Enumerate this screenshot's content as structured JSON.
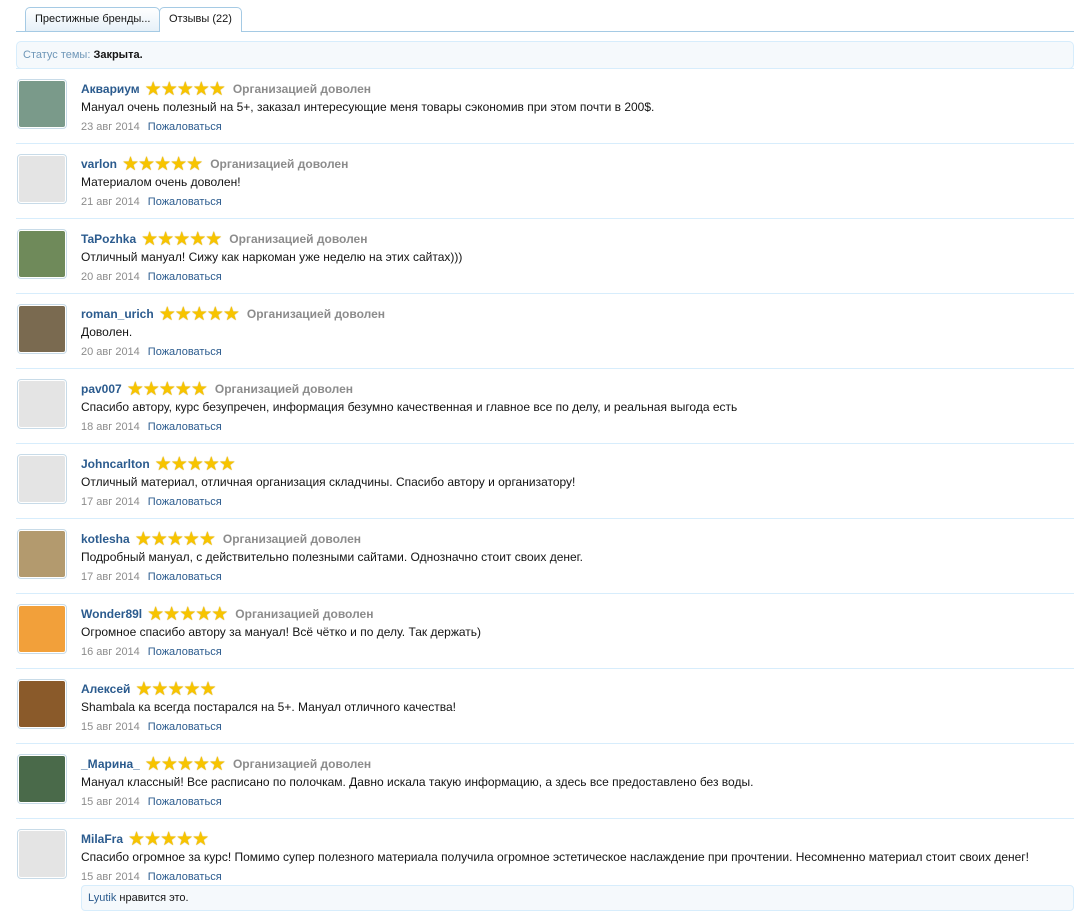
{
  "tabs": [
    {
      "label": "Престижные бренды..."
    },
    {
      "label": "Отзывы (22)"
    }
  ],
  "status": {
    "label": "Статус темы:",
    "value": "Закрыта."
  },
  "report_label": "Пожаловаться",
  "stars": "★★★★★",
  "rating_max": 5,
  "reviews": [
    {
      "name": "Аквариум",
      "rating": 5,
      "rating_text": "Организацией доволен",
      "message": "Мануал очень полезный на 5+, заказал интересующие меня товары сэкономив при этом почти в 200$.",
      "date": "23 авг 2014",
      "avatar_color": "#7a9a8a"
    },
    {
      "name": "varlon",
      "rating": 5,
      "rating_text": "Организацией доволен",
      "message": "Материалом очень доволен!",
      "date": "21 авг 2014",
      "avatar_color": "#e4e4e4"
    },
    {
      "name": "TaPozhka",
      "rating": 5,
      "rating_text": "Организацией доволен",
      "message": "Отличный мануал! Сижу как наркоман уже неделю на этих сайтах)))",
      "date": "20 авг 2014",
      "avatar_color": "#6f8a5a"
    },
    {
      "name": "roman_urich",
      "rating": 5,
      "rating_text": "Организацией доволен",
      "message": "Доволен.",
      "date": "20 авг 2014",
      "avatar_color": "#7a6a50"
    },
    {
      "name": "pav007",
      "rating": 5,
      "rating_text": "Организацией доволен",
      "message": "Спасибо автору, курс безупречен, информация безумно качественная и главное все по делу, и реальная выгода есть",
      "date": "18 авг 2014",
      "avatar_color": "#e4e4e4"
    },
    {
      "name": "Johncarlton",
      "rating": 5,
      "rating_text": "",
      "message": "Отличный материал, отличная организация складчины. Спасибо автору и организатору!",
      "date": "17 авг 2014",
      "avatar_color": "#e4e4e4"
    },
    {
      "name": "kotlesha",
      "rating": 5,
      "rating_text": "Организацией доволен",
      "message": "Подробный мануал, с действительно полезными сайтами. Однозначно стоит своих денег.",
      "date": "17 авг 2014",
      "avatar_color": "#b39a6e"
    },
    {
      "name": "Wonder89l",
      "rating": 5,
      "rating_text": "Организацией доволен",
      "message": "Огромное спасибо автору за мануал! Всё чётко и по делу. Так держать)",
      "date": "16 авг 2014",
      "avatar_color": "#f2a03a"
    },
    {
      "name": "Алексей",
      "rating": 5,
      "rating_text": "",
      "message": "Shambala ка всегда постарался на 5+. Мануал отличного качества!",
      "date": "15 авг 2014",
      "avatar_color": "#8a5a2a"
    },
    {
      "name": "_Марина_",
      "rating": 5,
      "rating_text": "Организацией доволен",
      "message": "Мануал классный! Все расписано по полочкам. Давно искала такую информацию, а здесь все предоставлено без воды.",
      "date": "15 авг 2014",
      "avatar_color": "#4a6a4a"
    },
    {
      "name": "MilaFra",
      "rating": 5,
      "rating_text": "",
      "message": "Спасибо огромное за курс! Помимо супер полезного материала получила огромное эстетическое наслаждение при прочтении. Несомненно материал стоит своих денег!",
      "date": "15 авг 2014",
      "avatar_color": "#e4e4e4"
    }
  ],
  "likes": {
    "user": "Lyutik",
    "text": " нравится это."
  }
}
